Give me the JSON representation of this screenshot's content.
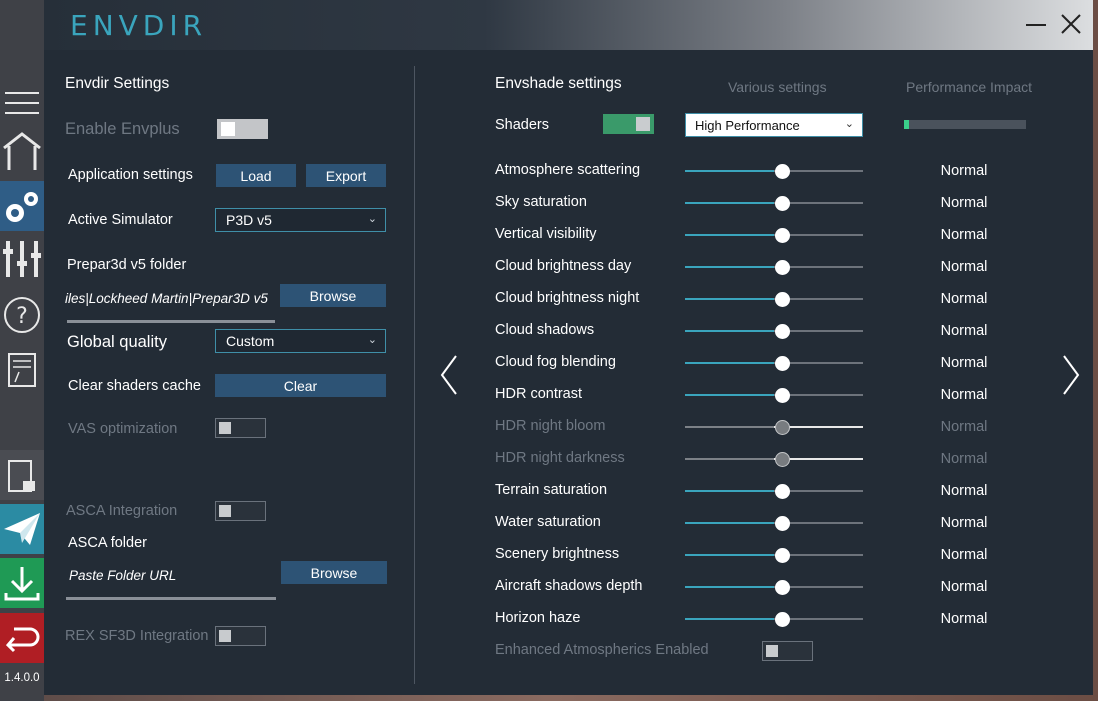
{
  "app": {
    "title": "ENVDIR"
  },
  "version": "1.4.0.0",
  "colors": {
    "accent": "#3aa5bd",
    "button": "#2d5375",
    "panel": "#232c36",
    "sidebar": "#3f4147",
    "toggle_on": "#3a9a6a"
  },
  "sidebar": {
    "icons": [
      "menu-icon",
      "home-icon",
      "settings-icon",
      "sliders-icon",
      "help-icon",
      "notes-icon",
      "save-file-icon",
      "send-icon",
      "download-icon",
      "undo-icon"
    ]
  },
  "left": {
    "heading": "Envdir Settings",
    "enable_envplus": {
      "label": "Enable Envplus",
      "on": true
    },
    "app_settings": {
      "label": "Application settings",
      "load": "Load",
      "export": "Export"
    },
    "active_sim": {
      "label": "Active Simulator",
      "value": "P3D v5"
    },
    "folder": {
      "label": "Prepar3d v5 folder",
      "path": "iles|Lockheed Martin|Prepar3D v5",
      "browse": "Browse"
    },
    "global_quality": {
      "label": "Global quality",
      "value": "Custom"
    },
    "clear_cache": {
      "label": "Clear shaders cache",
      "button": "Clear"
    },
    "vas": {
      "label": "VAS optimization",
      "on": false
    },
    "asca": {
      "label": "ASCA Integration",
      "on": false
    },
    "asca_folder": {
      "label": "ASCA folder",
      "placeholder": "Paste Folder URL",
      "browse": "Browse"
    },
    "rex": {
      "label": "REX SF3D Integration",
      "on": false
    }
  },
  "right": {
    "heading": "Envshade settings",
    "col_various": "Various settings",
    "col_impact": "Performance Impact",
    "shaders": {
      "label": "Shaders",
      "on": true,
      "mode": "High Performance",
      "impact_level": 0.04
    },
    "rows": [
      {
        "label": "Atmosphere scattering",
        "value": 0.5,
        "impact": "Normal",
        "enabled": true
      },
      {
        "label": "Sky saturation",
        "value": 0.5,
        "impact": "Normal",
        "enabled": true
      },
      {
        "label": "Vertical visibility",
        "value": 0.5,
        "impact": "Normal",
        "enabled": true
      },
      {
        "label": "Cloud brightness day",
        "value": 0.5,
        "impact": "Normal",
        "enabled": true
      },
      {
        "label": "Cloud brightness night",
        "value": 0.5,
        "impact": "Normal",
        "enabled": true
      },
      {
        "label": "Cloud shadows",
        "value": 0.5,
        "impact": "Normal",
        "enabled": true
      },
      {
        "label": "Cloud fog blending",
        "value": 0.5,
        "impact": "Normal",
        "enabled": true
      },
      {
        "label": "HDR contrast",
        "value": 0.5,
        "impact": "Normal",
        "enabled": true
      },
      {
        "label": "HDR night bloom",
        "value": 0.5,
        "impact": "Normal",
        "enabled": false
      },
      {
        "label": "HDR night darkness",
        "value": 0.5,
        "impact": "Normal",
        "enabled": false
      },
      {
        "label": "Terrain saturation",
        "value": 0.5,
        "impact": "Normal",
        "enabled": true
      },
      {
        "label": "Water saturation",
        "value": 0.5,
        "impact": "Normal",
        "enabled": true
      },
      {
        "label": "Scenery brightness",
        "value": 0.5,
        "impact": "Normal",
        "enabled": true
      },
      {
        "label": "Aircraft shadows depth",
        "value": 0.5,
        "impact": "Normal",
        "enabled": true
      },
      {
        "label": "Horizon haze",
        "value": 0.5,
        "impact": "Normal",
        "enabled": true
      }
    ],
    "enhanced": {
      "label": "Enhanced Atmospherics Enabled",
      "on": false
    }
  }
}
